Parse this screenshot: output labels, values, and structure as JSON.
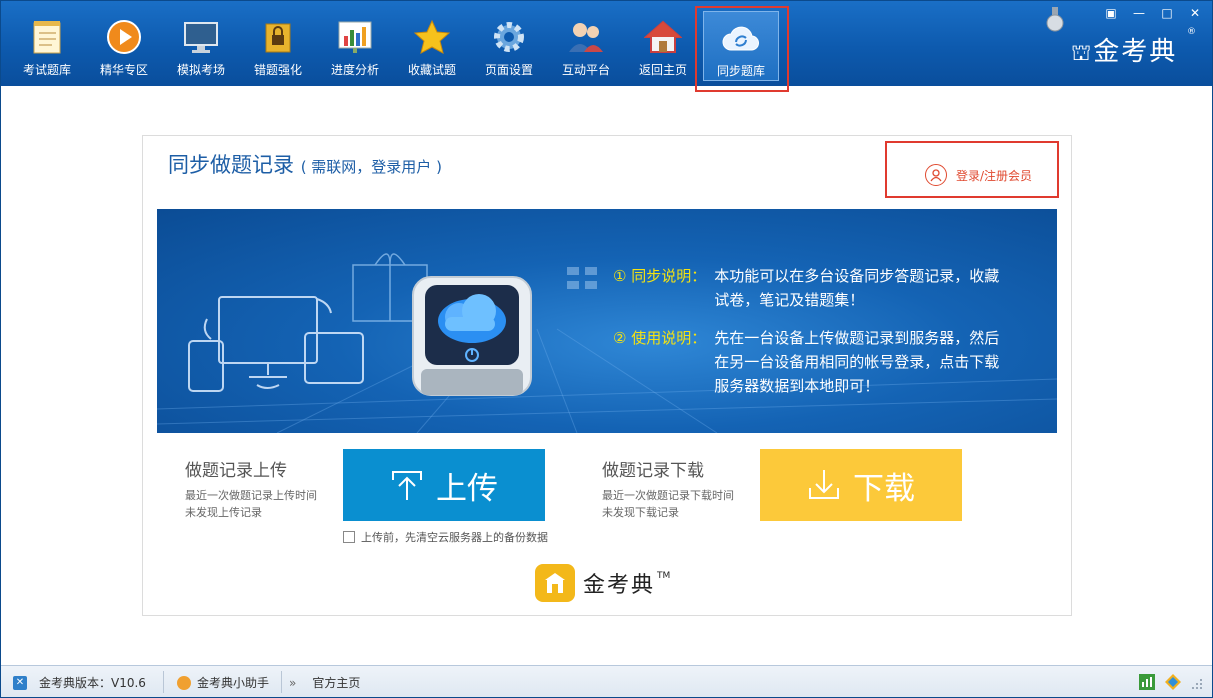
{
  "toolbar": {
    "items": [
      {
        "label": "考试题库",
        "icon": "notepad-icon"
      },
      {
        "label": "精华专区",
        "icon": "play-icon"
      },
      {
        "label": "模拟考场",
        "icon": "monitor-icon"
      },
      {
        "label": "错题强化",
        "icon": "lock-book-icon"
      },
      {
        "label": "进度分析",
        "icon": "bar-chart-icon"
      },
      {
        "label": "收藏试题",
        "icon": "star-icon"
      },
      {
        "label": "页面设置",
        "icon": "gear-icon"
      },
      {
        "label": "互动平台",
        "icon": "users-icon"
      },
      {
        "label": "返回主页",
        "icon": "home-icon"
      },
      {
        "label": "同步题库",
        "icon": "cloud-sync-icon"
      }
    ],
    "brand": "金考典",
    "brand_reg": "®"
  },
  "sync": {
    "title": "同步做题记录",
    "subtitle": "( 需联网，登录用户 )",
    "login_label": "登录/注册会员",
    "info_sync_key": "① 同步说明：",
    "info_sync_text": "本功能可以在多台设备同步答题记录，收藏试卷，笔记及错题集！",
    "info_use_key": "② 使用说明：",
    "info_use_text": "先在一台设备上传做题记录到服务器，然后在另一台设备用相同的帐号登录，点击下载服务器数据到本地即可！"
  },
  "upload": {
    "title": "做题记录上传",
    "line1": "最近一次做题记录上传时间",
    "line2": "未发现上传记录",
    "button": "上传",
    "checkbox_label": "上传前，先清空云服务器上的备份数据"
  },
  "download": {
    "title": "做题记录下载",
    "line1": "最近一次做题记录下载时间",
    "line2": "未发现下载记录",
    "button": "下载"
  },
  "footer_logo": {
    "text": "金考典",
    "tm": "TM"
  },
  "status": {
    "version": "金考典版本：V10.6",
    "assistant": "金考典小助手",
    "homepage": "官方主页"
  },
  "colors": {
    "accent": "#0a8fd0",
    "download": "#fcc93a",
    "toolbar": "#0d5aae",
    "highlight": "#e03a2f"
  }
}
